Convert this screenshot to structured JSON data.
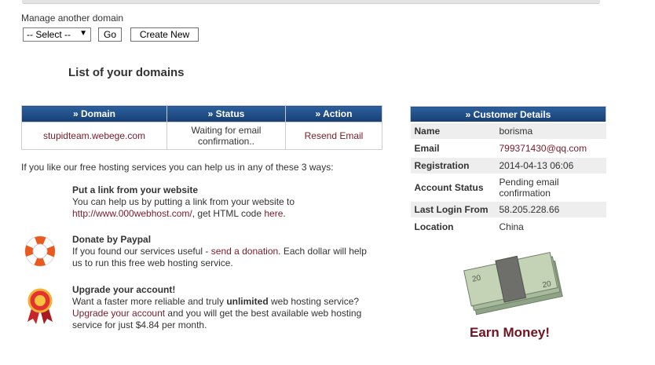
{
  "manage": {
    "label": "Manage another domain",
    "select_value": "-- Select --",
    "go_label": "Go",
    "create_label": "Create New"
  },
  "list_title": "List of your domains",
  "domains_table": {
    "headers": [
      "» Domain",
      "» Status",
      "» Action"
    ],
    "rows": [
      {
        "domain": "stupidteam.webege.com",
        "status": "Waiting for email confirmation..",
        "action": "Resend Email"
      }
    ]
  },
  "help": {
    "intro": "If you like our free hosting services you can help us in any of these 3 ways:",
    "link_title": "Put a link from your website",
    "link_text_1": "You can help us by putting a link from your website to",
    "link_url": "http://www.000webhost.com/",
    "link_text_2": ", get HTML code ",
    "link_here": "here",
    "link_text_3": ".",
    "donate_title": "Donate by Paypal",
    "donate_text_1": "If you found our services useful - ",
    "donate_link": "send a donation",
    "donate_text_2": ". Each dollar will help us to run this free web hosting service.",
    "upgrade_title": "Upgrade your account!",
    "upgrade_text_1": "Want a faster more reliable and truly ",
    "upgrade_bold": "unlimited",
    "upgrade_text_2": " web hosting service? ",
    "upgrade_link": "Upgrade your account",
    "upgrade_text_3": " and you will get the best available web hosting service for just $4.84 per month."
  },
  "customer": {
    "header": "» Customer Details",
    "rows": [
      {
        "label": "Name",
        "value": "borisma"
      },
      {
        "label": "Email",
        "value": "799371430@qq.com"
      },
      {
        "label": "Registration",
        "value": "2014-04-13 06:06"
      },
      {
        "label": "Account Status",
        "value": "Pending email confirmation"
      },
      {
        "label": "Last Login From",
        "value": "58.205.228.66"
      },
      {
        "label": "Location",
        "value": "China"
      }
    ]
  },
  "earn_money": "Earn Money!",
  "colors": {
    "header_blue": "#1d4f8a",
    "link": "#7a1a2a",
    "earn": "#6e1422"
  },
  "icons": [
    "lifebuoy-icon",
    "award-ribbon-icon",
    "money-stack-icon"
  ]
}
